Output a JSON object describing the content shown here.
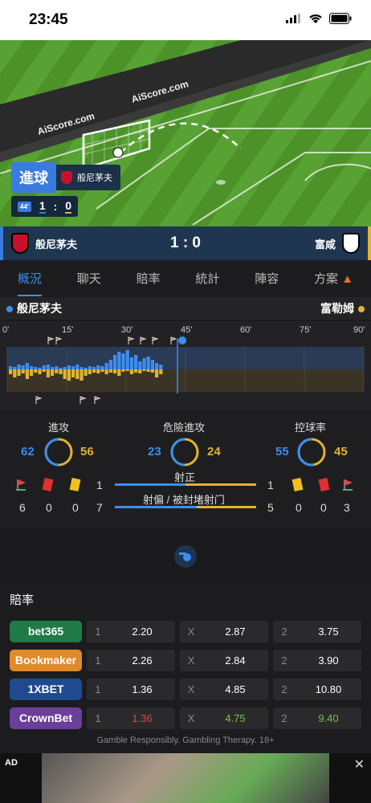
{
  "status_bar": {
    "time": "23:45"
  },
  "pitch": {
    "watermark_1": "AiScore.com",
    "watermark_2": "AiScore.com"
  },
  "goal_alert": {
    "label": "進球",
    "team": "般尼茅夫"
  },
  "mini_score": {
    "minute": "44'",
    "home": "1",
    "sep": ":",
    "away": "0"
  },
  "scorebar": {
    "home": "般尼茅夫",
    "score": "1 : 0",
    "away": "富咸"
  },
  "tabs": [
    "概況",
    "聊天",
    "賠率",
    "統計",
    "陣容",
    "方案"
  ],
  "teamline": {
    "home": "般尼茅夫",
    "away": "富勒姆",
    "home_color": "#3a8ef0",
    "away_color": "#e2b32f"
  },
  "timeline": {
    "ticks": [
      "0'",
      "15'",
      "30'",
      "45'",
      "60'",
      "75'",
      "90'"
    ]
  },
  "stats": {
    "attack": {
      "label": "進攻",
      "home": "62",
      "away": "56"
    },
    "dangerous": {
      "label": "危險進攻",
      "home": "23",
      "away": "24"
    },
    "possession": {
      "label": "控球率",
      "home": "55",
      "away": "45"
    },
    "on_target": {
      "label": "射正",
      "home": "1",
      "away": "1"
    },
    "off_target": {
      "label": "射偏 / 被封堵射门",
      "home": "7",
      "away": "5"
    },
    "home_counts": [
      "6",
      "0",
      "0"
    ],
    "away_counts": [
      "0",
      "0",
      "3"
    ]
  },
  "odds": {
    "title": "賠率",
    "rows": [
      {
        "book": "bet365",
        "color": "#1f7a45",
        "h_key": "1",
        "h": "2.20",
        "d_key": "X",
        "d": "2.87",
        "a_key": "2",
        "a": "3.75",
        "hc": "#fff",
        "dc": "#fff",
        "ac": "#fff"
      },
      {
        "book": "Bookmaker",
        "color": "#e08a2b",
        "h_key": "1",
        "h": "2.26",
        "d_key": "X",
        "d": "2.84",
        "a_key": "2",
        "a": "3.90",
        "hc": "#fff",
        "dc": "#fff",
        "ac": "#fff"
      },
      {
        "book": "1XBET",
        "color": "#1f4a8f",
        "h_key": "1",
        "h": "1.36",
        "d_key": "X",
        "d": "4.85",
        "a_key": "2",
        "a": "10.80",
        "hc": "#fff",
        "dc": "#fff",
        "ac": "#fff"
      },
      {
        "book": "CrownBet",
        "color": "#6a3f9a",
        "h_key": "1",
        "h": "1.36",
        "d_key": "X",
        "d": "4.75",
        "a_key": "2",
        "a": "9.40",
        "hc": "#e04545",
        "dc": "#7bc043",
        "ac": "#7bc043"
      }
    ],
    "disclaimer": "Gamble Responsibly. Gambling Therapy. 18+"
  },
  "ad": {
    "label": "AD"
  }
}
